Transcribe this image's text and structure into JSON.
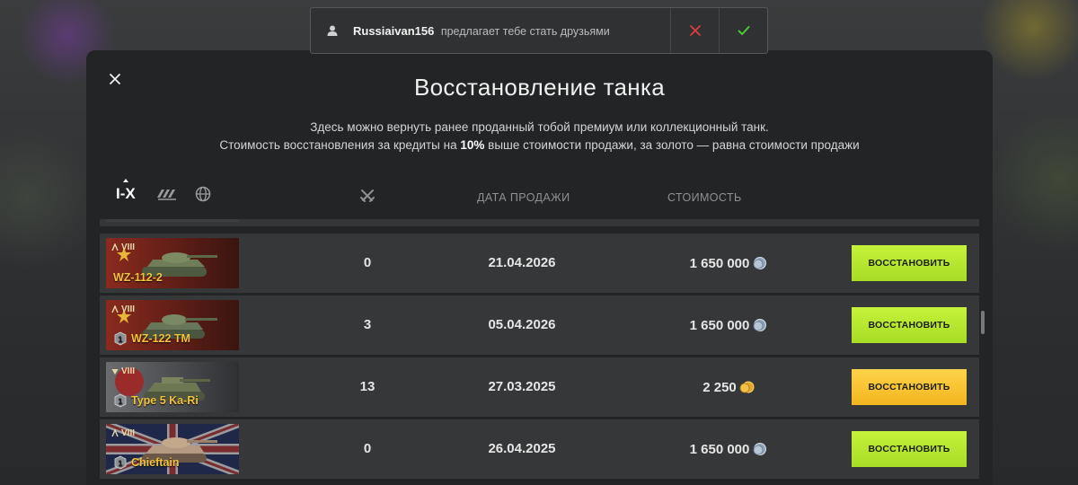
{
  "notification": {
    "username": "Russiaivan156",
    "message": "предлагает тебе стать друзьями"
  },
  "dialog": {
    "title": "Восстановление танка",
    "desc_line1": "Здесь можно вернуть ранее проданный тобой премиум или коллекционный танк.",
    "desc_line2_prefix": "Стоимость восстановления за кредиты на",
    "desc_line2_bold": "10%",
    "desc_line2_suffix": "выше стоимости продажи, за золото — равна стоимости продажи"
  },
  "filters": {
    "tier_tab": "I-X"
  },
  "columns": {
    "sale_date": "ДАТА ПРОДАЖИ",
    "cost": "СТОИМОСТЬ"
  },
  "colors": {
    "restore_credits": "#b4e52e",
    "restore_gold": "#f7c230",
    "tank_name": "#f4c33c"
  },
  "rows": [
    {
      "tier": "VIII",
      "name": "WZ-112-2",
      "battles": "0",
      "date": "21.04.2026",
      "price": "1 650 000",
      "currency": "credits",
      "button": "ВОССТАНОВИТЬ",
      "flag": "china",
      "badge": false
    },
    {
      "tier": "VIII",
      "name": "WZ-122 TM",
      "battles": "3",
      "date": "05.04.2026",
      "price": "1 650 000",
      "currency": "credits",
      "button": "ВОССТАНОВИТЬ",
      "flag": "china",
      "badge": true
    },
    {
      "tier": "VIII",
      "name": "Type 5 Ka-Ri",
      "battles": "13",
      "date": "27.03.2025",
      "price": "2 250",
      "currency": "gold",
      "button": "ВОССТАНОВИТЬ",
      "flag": "japan",
      "badge": true
    },
    {
      "tier": "VIII",
      "name": "Chieftain",
      "battles": "0",
      "date": "26.04.2025",
      "price": "1 650 000",
      "currency": "credits",
      "button": "ВОССТАНОВИТЬ",
      "flag": "uk",
      "badge": true
    }
  ]
}
